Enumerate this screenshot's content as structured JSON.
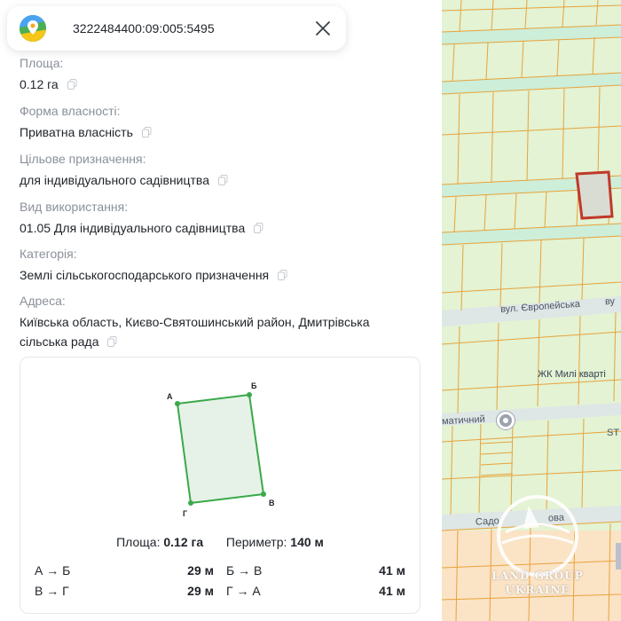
{
  "header": {
    "cadastral_number": "3222484400:09:005:5495",
    "close_icon": "close-icon",
    "logo_icon": "map-pin-logo-icon"
  },
  "fields": [
    {
      "label": "Площа:",
      "value": "0.12 га"
    },
    {
      "label": "Форма власності:",
      "value": "Приватна власність"
    },
    {
      "label": "Цільове призначення:",
      "value": "для індивідуального садівництва"
    },
    {
      "label": "Вид використання:",
      "value": "01.05 Для індивідуального садівництва"
    },
    {
      "label": "Категорія:",
      "value": "Землі сільськогосподарського призначення"
    },
    {
      "label": "Адреса:",
      "value_line1": "Київська область, Києво-Святошинський район, Дмитрівська",
      "value_line2": "сільська рада"
    }
  ],
  "card": {
    "vertices": {
      "a": "А",
      "b": "Б",
      "v": "В",
      "g": "Г"
    },
    "area_label": "Площа:",
    "area_value": "0.12 га",
    "perimeter_label": "Периметр:",
    "perimeter_value": "140 м",
    "segments": [
      {
        "label": "А → Б",
        "value": "29 м"
      },
      {
        "label": "Б → В",
        "value": "41 м"
      },
      {
        "label": "В → Г",
        "value": "29 м"
      },
      {
        "label": "Г → А",
        "value": "41 м"
      }
    ],
    "shape_fill": "#e6f2e8",
    "shape_stroke": "#3aa94a"
  },
  "map": {
    "street_1": "вул. Європейська",
    "street_1_suffix": "ву",
    "poi_1": "ЖК Милі кварті",
    "street_2": "матичний",
    "street_2_suffix": "ST",
    "street_3": "Садо",
    "street_3_suffix": "ова",
    "watermark_line1": "LAND GROUP",
    "watermark_line2": "UKRAINE",
    "parcel_line_color": "#e8a23a",
    "selected_parcel_color": "#c0392b",
    "background_color": "#e6f4d8"
  }
}
